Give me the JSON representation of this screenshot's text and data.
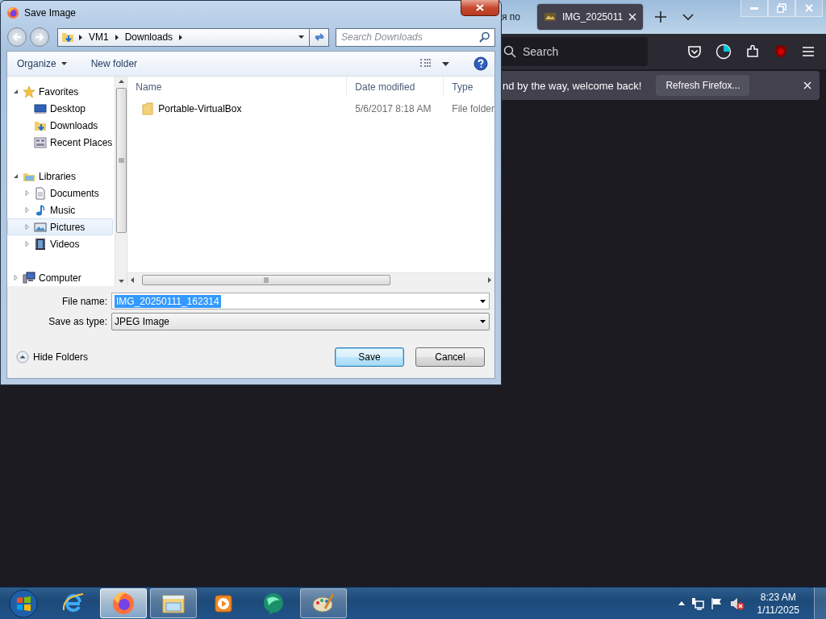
{
  "browser": {
    "tabs": [
      {
        "label": "я по",
        "selected": false
      },
      {
        "label": "IMG_2025011",
        "selected": true
      }
    ],
    "search": {
      "placeholder": "Search"
    },
    "notification": {
      "message": "nd by the way, welcome back!",
      "button": "Refresh Firefox..."
    }
  },
  "dialog": {
    "title": "Save Image",
    "breadcrumb": [
      "VM1",
      "Downloads"
    ],
    "search": {
      "placeholder": "Search Downloads"
    },
    "toolbar": {
      "organize": "Organize",
      "new_folder": "New folder"
    },
    "nav": [
      {
        "label": "Favorites",
        "kind": "star",
        "expanded": true,
        "selected": false,
        "children": [
          {
            "label": "Desktop",
            "kind": "desktop",
            "selected": false
          },
          {
            "label": "Downloads",
            "kind": "downloads",
            "selected": false
          },
          {
            "label": "Recent Places",
            "kind": "recent",
            "selected": false
          }
        ]
      },
      {
        "label": "Libraries",
        "kind": "library",
        "expanded": true,
        "selected": false,
        "children": [
          {
            "label": "Documents",
            "kind": "document",
            "expanded": false,
            "selected": false
          },
          {
            "label": "Music",
            "kind": "music",
            "expanded": false,
            "selected": false
          },
          {
            "label": "Pictures",
            "kind": "pictures",
            "expanded": false,
            "selected": true
          },
          {
            "label": "Videos",
            "kind": "videos",
            "expanded": false,
            "selected": false
          }
        ]
      },
      {
        "label": "Computer",
        "kind": "computer",
        "expanded": false,
        "selected": false
      }
    ],
    "columns": [
      "Name",
      "Date modified",
      "Type"
    ],
    "rows": [
      {
        "name": "Portable-VirtualBox",
        "date": "5/6/2017 8:18 AM",
        "type": "File folder"
      }
    ],
    "file_name": {
      "label": "File name:",
      "value": "IMG_20250111_162314"
    },
    "save_type": {
      "label": "Save as type:",
      "value": "JPEG Image"
    },
    "hide_folders": "Hide Folders",
    "buttons": [
      {
        "label": "Save",
        "default": true
      },
      {
        "label": "Cancel",
        "default": false
      }
    ]
  },
  "taskbar": {
    "apps": [
      {
        "kind": "ie",
        "running": false,
        "selected": false
      },
      {
        "kind": "firefox",
        "running": true,
        "selected": true
      },
      {
        "kind": "explorer",
        "running": true,
        "selected": false
      },
      {
        "kind": "media",
        "running": false,
        "selected": false
      },
      {
        "kind": "chat",
        "running": false,
        "selected": false
      },
      {
        "kind": "paint",
        "running": true,
        "selected": false
      }
    ],
    "time": "8:23 AM",
    "date": "1/11/2025"
  }
}
